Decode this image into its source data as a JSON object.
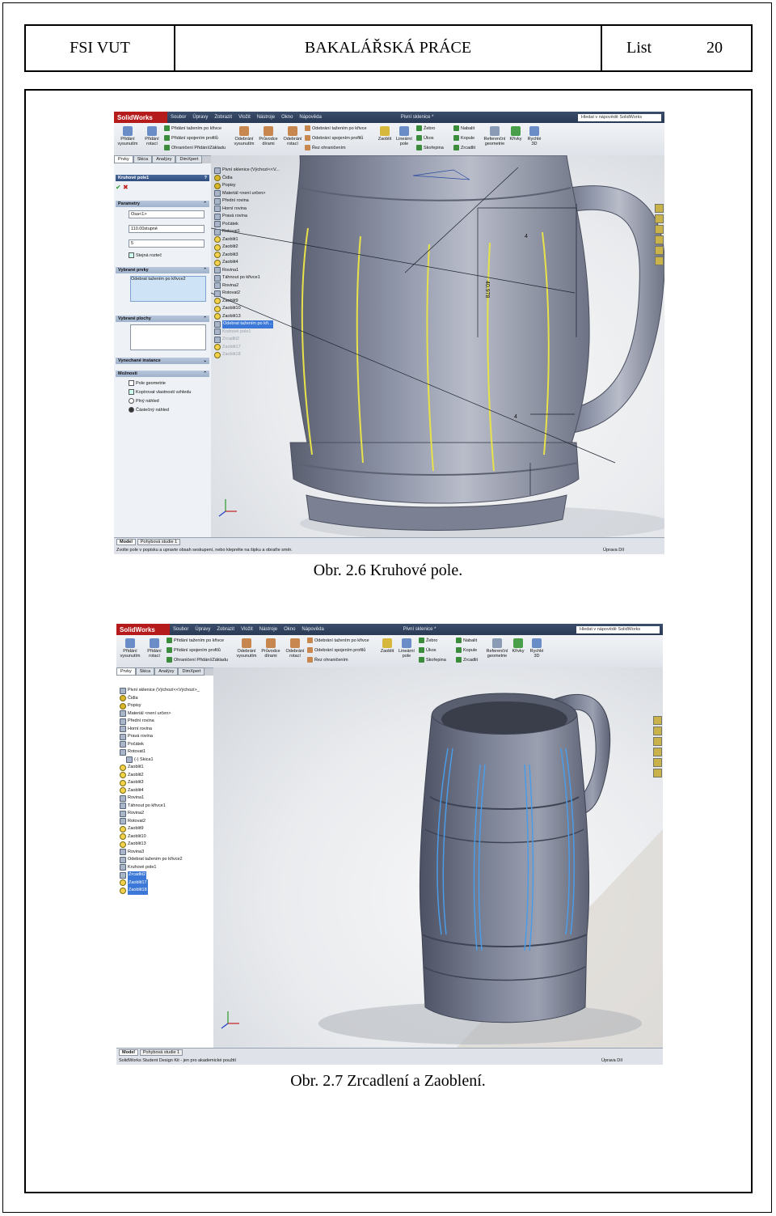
{
  "header": {
    "left": "FSI VUT",
    "center": "BAKALÁŘSKÁ PRÁCE",
    "list_label": "List",
    "page_number": "20"
  },
  "figure1": {
    "caption": "Obr. 2.6 Kruhové pole.",
    "screenshot": {
      "logo": "SolidWorks",
      "menu": [
        "Soubor",
        "Úpravy",
        "Zobrazit",
        "Vložit",
        "Nástroje",
        "Okno",
        "Nápověda"
      ],
      "doc_name": "Pivní sklenice *",
      "search_placeholder": "Hledat v nápovědě SolidWorks",
      "ribbon": {
        "extrude_boss": "Přidání vysunutím",
        "revolve_boss": "Přidání rotací",
        "sweep_boss": "Přidání tažením po křivce",
        "loft_boss": "Přidání spojením profilů",
        "boundary_boss": "Ohraničení Přidání/Základu",
        "extrude_cut": "Odebrání vysunutím",
        "hole_wizard": "Průvodce dírami",
        "revolve_cut": "Odebrání rotací",
        "sweep_cut": "Odebrání tažením po křivce",
        "loft_cut": "Odebrání spojením profilů",
        "boundary_cut": "Řez ohraničením",
        "fillet": "Zaoblit",
        "linear_pattern": "Lineární pole",
        "rib": "Žebro",
        "draft": "Úkos",
        "shell": "Skořepina",
        "wrap": "Nabalit",
        "dome": "Kopule",
        "mirror": "Zrcadlit",
        "ref_geometry": "Referenční geometrie",
        "curves": "Křivky",
        "instant3d": "Rychlé 3D"
      },
      "tabs": [
        "Prvky",
        "Skica",
        "Analýzy",
        "DimXpert"
      ],
      "property_manager": {
        "title": "Kruhové pole1",
        "parameters_header": "Parametry",
        "axis": "Osa<1>",
        "angle": "110.00stupně",
        "count": "5",
        "equal_spacing": "Stejná rozteč",
        "features_header": "Vybrané prvky",
        "feature_item": "Odebrat tažením po křivce2",
        "faces_header": "Vybrané plochy",
        "skip_header": "Vynechané instance",
        "options_header": "Možnosti",
        "opt_geometry": "Pole geometrie",
        "opt_copy_visual": "Kopírovat vlastnosti vzhledu",
        "opt_full_preview": "Plný náhled",
        "opt_partial_preview": "Částečný náhled"
      },
      "tree": [
        "Pivní sklenice (Výchozí<<V...",
        "Čidla",
        "Popisy",
        "Materiál <není určen>",
        "Přední rovina",
        "Horní rovina",
        "Pravá rovina",
        "Počátek",
        "Rotovat1",
        "Zaoblit1",
        "Zaoblit2",
        "Zaoblit3",
        "Zaoblit4",
        "Rovina1",
        "Táhnout po křivce1",
        "Rovina2",
        "Rotovat2",
        "Zaoblit9",
        "Zaoblit10",
        "Zaoblit13",
        "Odebrat tažením po kři...",
        "Kruhové pole1",
        "Zrcadlit2",
        "Zaoblit17",
        "Zaoblit18"
      ],
      "dimension": "40.978",
      "dim_small": "4",
      "bottom_tabs": [
        "Model",
        "Pohybová studie 1"
      ],
      "status": "Zvolte pole v popisku a upravte obsah seskupení, nebo klepněte na šipku a obraťte směr.",
      "status_right": "Úprava Díl"
    }
  },
  "figure2": {
    "caption": "Obr. 2.7 Zrcadlení a Zaoblení.",
    "screenshot": {
      "logo": "SolidWorks",
      "menu": [
        "Soubor",
        "Úpravy",
        "Zobrazit",
        "Vložit",
        "Nástroje",
        "Okno",
        "Nápověda"
      ],
      "doc_name": "Pivní sklenice *",
      "search_placeholder": "Hledat v nápovědě SolidWorks",
      "tabs": [
        "Prvky",
        "Skica",
        "Analýzy",
        "DimXpert"
      ],
      "tree": [
        "Pivní sklenice  (Výchozí<<Výchozí>_",
        "Čidla",
        "Popisy",
        "Materiál <není určen>",
        "Přední rovina",
        "Horní rovina",
        "Pravá rovina",
        "Počátek",
        "Rotovat1",
        "(-) Skica1",
        "Zaoblit1",
        "Zaoblit2",
        "Zaoblit3",
        "Zaoblit4",
        "Rovina1",
        "Táhnout po křivce1",
        "Rovina2",
        "Rotovat2",
        "Zaoblit9",
        "Zaoblit10",
        "Zaoblit13",
        "Rovina3",
        "Odebrat tažením po křivce2",
        "Kruhové pole1",
        "Zrcadlit2",
        "Zaoblit17",
        "Zaoblit18"
      ],
      "bottom_tabs": [
        "Model",
        "Pohybová studie 1"
      ],
      "status": "SolidWorks Student Design Kit - jen pro akademické použití",
      "status_right": "Úprava Díl"
    }
  }
}
